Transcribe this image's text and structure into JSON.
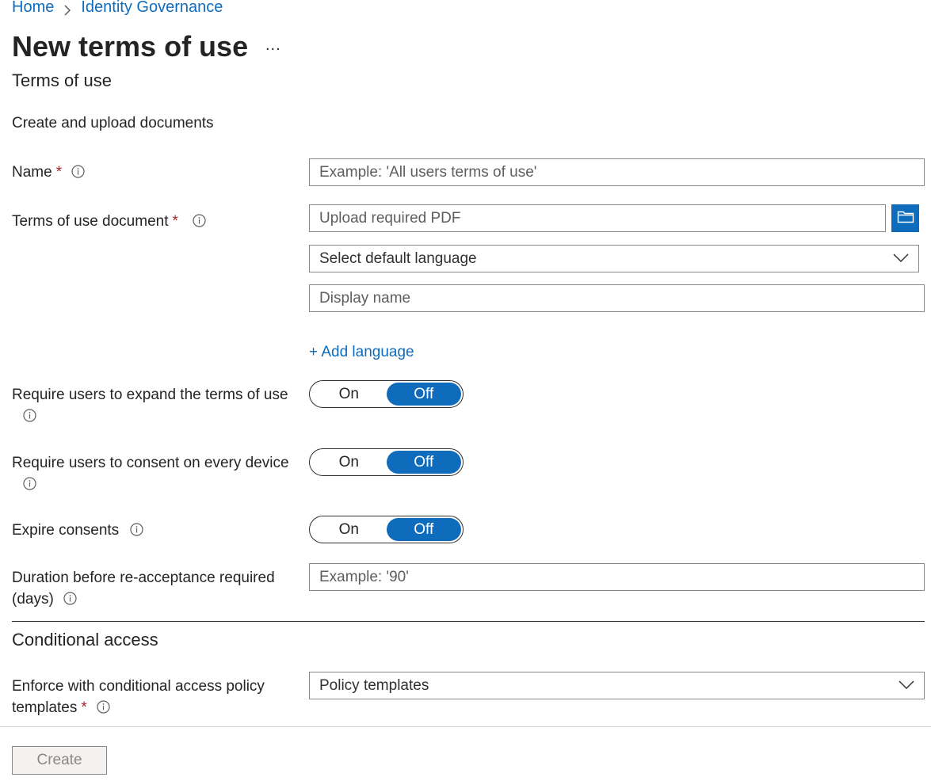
{
  "breadcrumb": {
    "home": "Home",
    "current": "Identity Governance"
  },
  "page": {
    "title": "New terms of use",
    "more": "...",
    "subtitle": "Terms of use",
    "section_desc": "Create and upload documents"
  },
  "form": {
    "name": {
      "label": "Name",
      "required": "*",
      "placeholder": "Example: 'All users terms of use'"
    },
    "document": {
      "label": "Terms of use document",
      "required": "*",
      "upload_placeholder": "Upload required PDF",
      "language_select": "Select default language",
      "display_name_placeholder": "Display name",
      "add_language": "+ Add language"
    },
    "expand": {
      "label_line1": "Require users to expand the terms of use",
      "on": "On",
      "off": "Off",
      "selected": "Off"
    },
    "consent_device": {
      "label": "Require users to consent on every device",
      "on": "On",
      "off": "Off",
      "selected": "Off"
    },
    "expire": {
      "label": "Expire consents",
      "on": "On",
      "off": "Off",
      "selected": "Off"
    },
    "duration": {
      "label_line1": "Duration before re-acceptance required",
      "label_line2": "(days)",
      "placeholder": "Example: '90'"
    }
  },
  "conditional_access": {
    "heading": "Conditional access",
    "label_line1": "Enforce with conditional access policy",
    "label_line2": "templates",
    "required": "*",
    "select": "Policy templates"
  },
  "footer": {
    "create": "Create"
  },
  "colors": {
    "accent": "#0f6cbd",
    "required": "#a4262c",
    "text": "#242424"
  }
}
